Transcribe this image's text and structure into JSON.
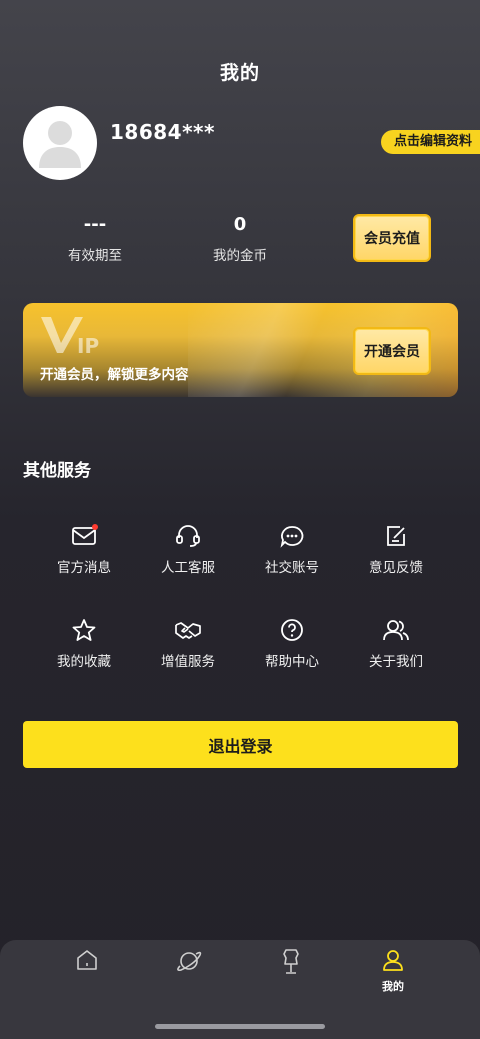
{
  "header": {
    "title": "我的"
  },
  "profile": {
    "username": "18684***",
    "edit_label": "点击编辑资料",
    "avatar_icon": "user-avatar-icon"
  },
  "stats": {
    "validity_value": "---",
    "validity_label": "有效期至",
    "coins_value": "0",
    "coins_label": "我的金币",
    "recharge_label": "会员充值"
  },
  "vip": {
    "logo_text": "VIP",
    "description": "开通会员，解锁更多内容",
    "open_label": "开通会员"
  },
  "services": {
    "title": "其他服务",
    "items": [
      {
        "label": "官方消息",
        "icon": "mail-icon"
      },
      {
        "label": "人工客服",
        "icon": "headset-icon"
      },
      {
        "label": "社交账号",
        "icon": "chat-bubble-icon"
      },
      {
        "label": "意见反馈",
        "icon": "feedback-edit-icon"
      },
      {
        "label": "我的收藏",
        "icon": "star-icon"
      },
      {
        "label": "增值服务",
        "icon": "handshake-icon"
      },
      {
        "label": "帮助中心",
        "icon": "help-icon"
      },
      {
        "label": "关于我们",
        "icon": "users-icon"
      }
    ]
  },
  "logout_label": "退出登录",
  "tabbar": {
    "items": [
      {
        "label": "",
        "icon": "home-icon"
      },
      {
        "label": "",
        "icon": "planet-icon"
      },
      {
        "label": "",
        "icon": "mannequin-icon"
      },
      {
        "label": "我的",
        "icon": "profile-icon",
        "active": true
      }
    ]
  },
  "colors": {
    "accent": "#fde01c",
    "gold": "#f2b915",
    "background": "#26252d",
    "notification": "#ff3b30"
  }
}
